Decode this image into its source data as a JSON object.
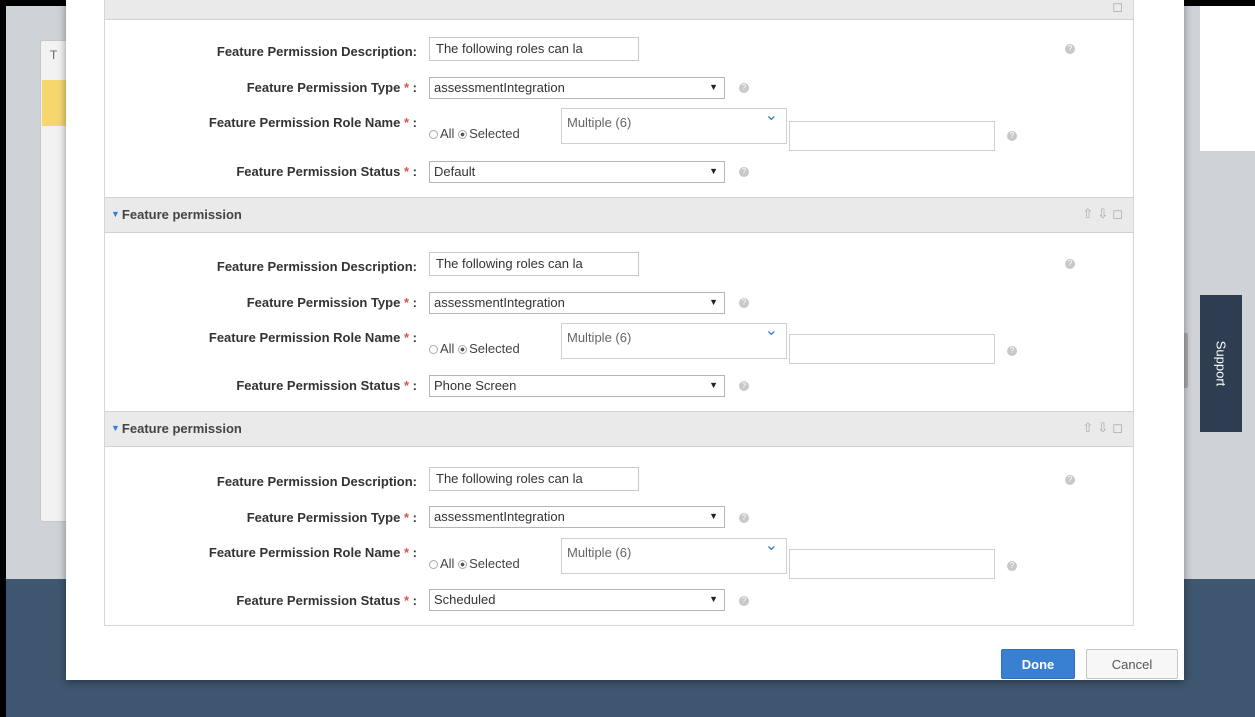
{
  "background": {
    "tab_letter": "T",
    "support_label": "Support"
  },
  "field_labels": {
    "description": "Feature Permission Description:",
    "type": "Feature Permission Type",
    "role_name": "Feature Permission Role Name",
    "status": "Feature Permission Status",
    "required_mark": "*",
    "colon": ":"
  },
  "section_title": "Feature permission",
  "radio_labels": {
    "all": "All",
    "selected": "Selected"
  },
  "help_glyph": "?",
  "permissions": [
    {
      "description": "The following roles can la",
      "type": "assessmentIntegration",
      "role_selection": "Selected",
      "roles": "Multiple (6)",
      "status": "Default"
    },
    {
      "description": "The following roles can la",
      "type": "assessmentIntegration",
      "role_selection": "Selected",
      "roles": "Multiple (6)",
      "status": "Phone Screen"
    },
    {
      "description": "The following roles can la",
      "type": "assessmentIntegration",
      "role_selection": "Selected",
      "roles": "Multiple (6)",
      "status": "Scheduled"
    }
  ],
  "footer": {
    "done_label": "Done",
    "cancel_label": "Cancel"
  },
  "colors": {
    "primary_button": "#3a80d2",
    "required": "#d9534f",
    "section_header": "#eaeaea",
    "support_tab": "#2e3e50"
  }
}
